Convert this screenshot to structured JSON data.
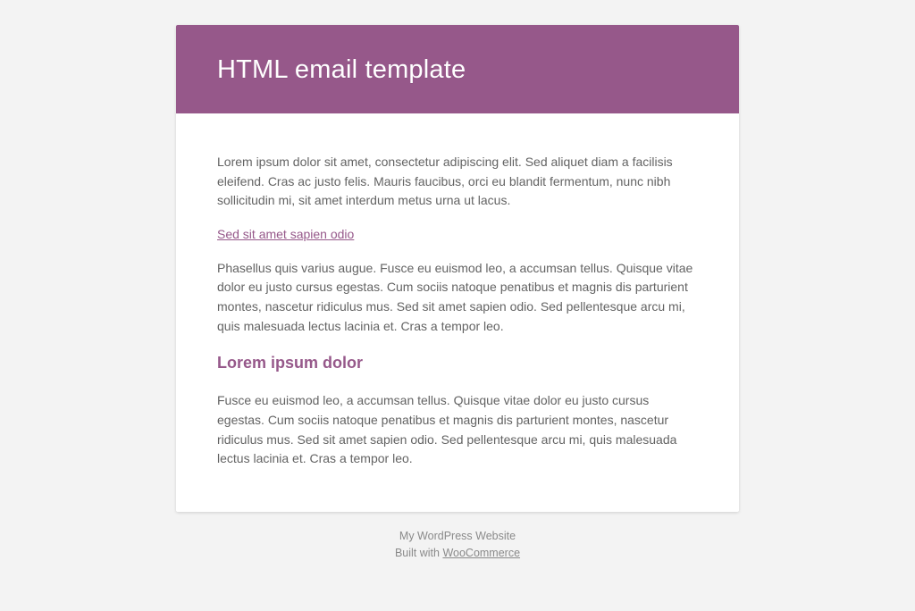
{
  "colors": {
    "accent": "#96588a",
    "body_text": "#636363",
    "page_bg": "#f3f3f3"
  },
  "header": {
    "title": "HTML email template"
  },
  "body": {
    "paragraph1": "Lorem ipsum dolor sit amet, consectetur adipiscing elit. Sed aliquet diam a facilisis eleifend. Cras ac justo felis. Mauris faucibus, orci eu blandit fermentum, nunc nibh sollicitudin mi, sit amet interdum metus urna ut lacus.",
    "link1_text": "Sed sit amet sapien odio",
    "paragraph2": "Phasellus quis varius augue. Fusce eu euismod leo, a accumsan tellus. Quisque vitae dolor eu justo cursus egestas. Cum sociis natoque penatibus et magnis dis parturient montes, nascetur ridiculus mus. Sed sit amet sapien odio. Sed pellentesque arcu mi, quis malesuada lectus lacinia et. Cras a tempor leo.",
    "heading2": "Lorem ipsum dolor",
    "paragraph3": "Fusce eu euismod leo, a accumsan tellus. Quisque vitae dolor eu justo cursus egestas. Cum sociis natoque penatibus et magnis dis parturient montes, nascetur ridiculus mus. Sed sit amet sapien odio. Sed pellentesque arcu mi, quis malesuada lectus lacinia et. Cras a tempor leo."
  },
  "footer": {
    "line1": "My WordPress Website",
    "built_prefix": "Built with ",
    "built_link": "WooCommerce"
  }
}
